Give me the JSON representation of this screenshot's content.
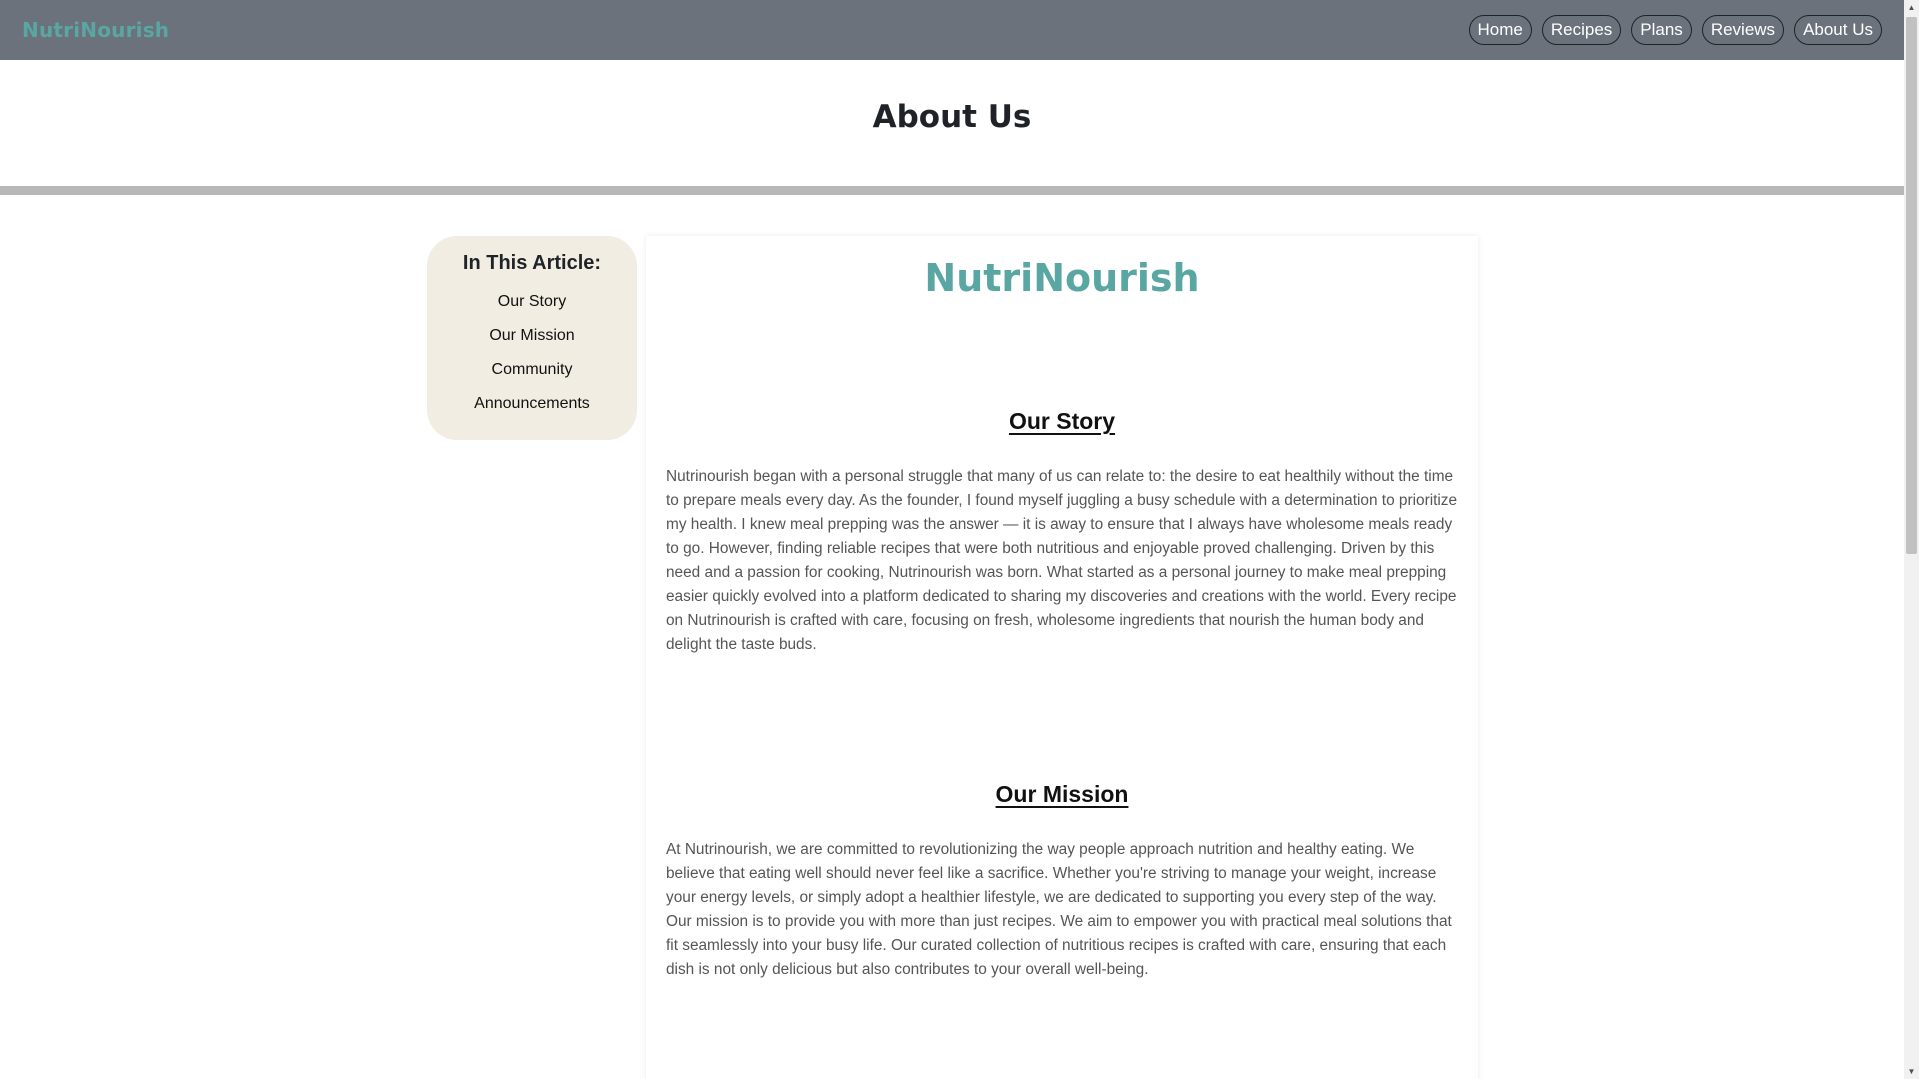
{
  "nav": {
    "brand": "NutriNourish",
    "links": [
      "Home",
      "Recipes",
      "Plans",
      "Reviews",
      "About Us"
    ]
  },
  "header": {
    "title": "About Us"
  },
  "toc": {
    "heading": "In This Article:",
    "items": [
      "Our Story",
      "Our Mission",
      "Community",
      "Announcements"
    ]
  },
  "article": {
    "brand": "NutriNourish",
    "sections": [
      {
        "title": "Our Story",
        "body": "Nutrinourish began with a personal struggle that many of us can relate to: the desire to eat healthily without the time to prepare meals every day. As the founder, I found myself juggling a busy schedule with a determination to prioritize my health. I knew meal prepping was the answer — it is away to ensure that I always have wholesome meals ready to go. However, finding reliable recipes that were both nutritious and enjoyable proved challenging. Driven by this need and a passion for cooking, Nutrinourish was born. What started as a personal journey to make meal prepping easier quickly evolved into a platform dedicated to sharing my discoveries and creations with the world. Every recipe on Nutrinourish is crafted with care, focusing on fresh, wholesome ingredients that nourish the human body and delight the taste buds."
      },
      {
        "title": "Our Mission",
        "body": "At Nutrinourish, we are committed to revolutionizing the way people approach nutrition and healthy eating. We believe that eating well should never feel like a sacrifice. Whether you're striving to manage your weight, increase your energy levels, or simply adopt a healthier lifestyle, we are dedicated to supporting you every step of the way. Our mission is to provide you with more than just recipes. We aim to empower you with practical meal solutions that fit seamlessly into your busy life. Our curated collection of nutritious recipes is crafted with care, ensuring that each dish is not only delicious but also contributes to your overall well-being."
      }
    ]
  },
  "scrollbar": {
    "up_icon": "triangle-up",
    "down_icon": "triangle-down"
  },
  "colors": {
    "navbar": "#6b727c",
    "brand": "#5aa6a2",
    "toc_background": "#f1ede3",
    "header_rule": "#b8b8b8"
  }
}
